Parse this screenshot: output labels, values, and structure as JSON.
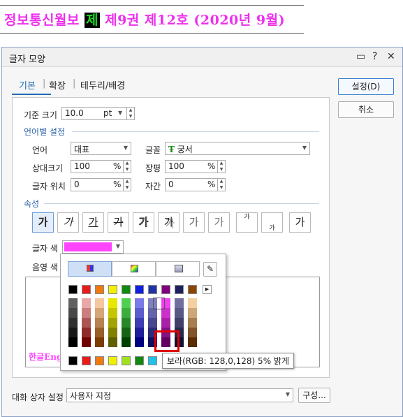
{
  "headline": {
    "pre": "정보통신월보 ",
    "hl": "제",
    "post": " 제9권 제12호 (2020년 9월)"
  },
  "dialog": {
    "title": "글자 모양",
    "help": "?",
    "close": "✕"
  },
  "tabs": [
    "기본",
    "확장",
    "테두리/배경"
  ],
  "buttons": {
    "ok": "설정(D)",
    "cancel": "취소",
    "compose": "구성..."
  },
  "size": {
    "label": "기준 크기",
    "value": "10.0",
    "unit": "pt"
  },
  "langgroup": "언어별 설정",
  "lang": {
    "label": "언어",
    "value": "대표"
  },
  "font": {
    "label": "글꼴",
    "value": "궁서",
    "icon": "Ŧ"
  },
  "relsize": {
    "label": "상대크기",
    "value": "100",
    "unit": "%"
  },
  "ratio": {
    "label": "장평",
    "value": "100",
    "unit": "%"
  },
  "pos": {
    "label": "글자 위치",
    "value": "0",
    "unit": "%"
  },
  "spacing": {
    "label": "자간",
    "value": "0",
    "unit": "%"
  },
  "attrgroup": "속성",
  "styles": [
    "가",
    "가",
    "가",
    "가",
    "가",
    "가",
    "가",
    "가",
    "가",
    "가",
    "가"
  ],
  "color": {
    "label": "글자 색",
    "value": "#ff44ff"
  },
  "shade": {
    "label": "음영 색"
  },
  "preview": "한글Eng",
  "dialogset": {
    "label": "대화 상자 설정",
    "value": "사용자 지정"
  },
  "tooltip": "보라(RGB: 128,0,128) 5% 밝게",
  "palette": {
    "row1": [
      "#000000",
      "#e81b1b",
      "#f07a10",
      "#f0f000",
      "#0f8a0f",
      "#0f1fe6",
      "#2233a8",
      "#800080",
      "#1f1f60",
      "#8b4500"
    ],
    "grad_base": [
      "#606060",
      "#e8a8a8",
      "#f4c8a0",
      "#e8e800",
      "#50d050",
      "#7a7ae8",
      "#8080c0",
      "#f040f0",
      "#7070a0",
      "#f4d0a0"
    ],
    "grad_dark": [
      "#000000",
      "#700000",
      "#7a3c00",
      "#606000",
      "#004000",
      "#000080",
      "#101060",
      "#600060",
      "#101030",
      "#5a2c00"
    ],
    "row_last": [
      "#000000",
      "#e81b1b",
      "#f07a10",
      "#f0f000",
      "#a0e020",
      "#0f8a0f",
      "#20c0e8"
    ]
  }
}
